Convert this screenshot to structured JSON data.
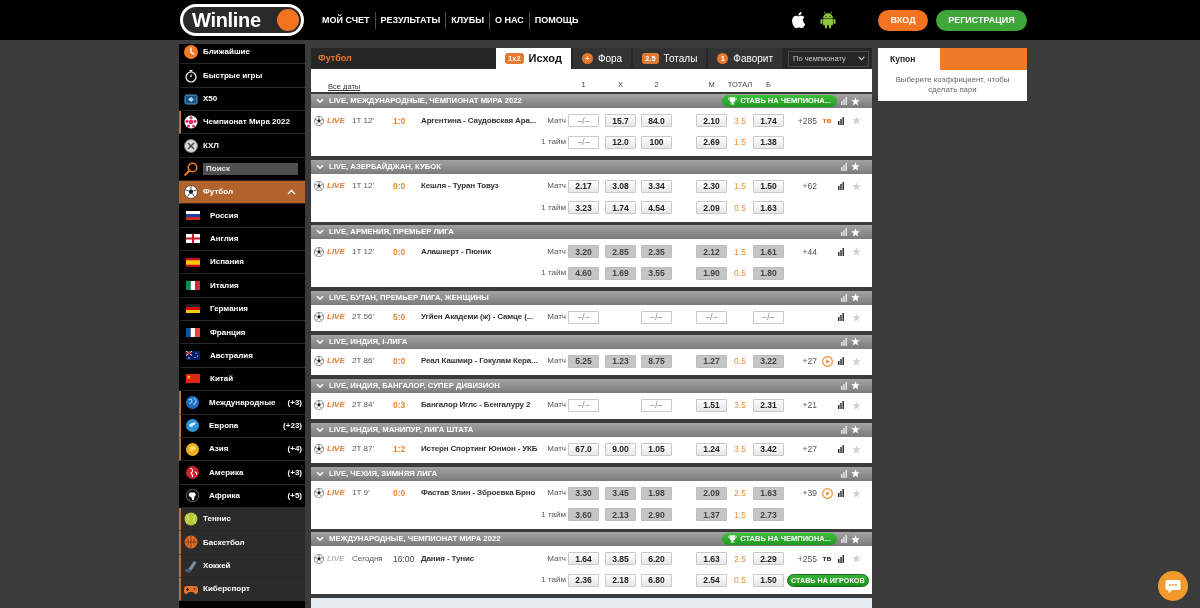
{
  "header": {
    "logo": "Winline",
    "nav": [
      "МОЙ СЧЕТ",
      "РЕЗУЛЬТАТЫ",
      "КЛУБЫ",
      "О НАС",
      "ПОМОЩЬ"
    ],
    "buttons": [
      {
        "kind": "login",
        "label": "ВХОД"
      },
      {
        "kind": "register",
        "label": "РЕГИСТРАЦИЯ"
      }
    ]
  },
  "sidebar": {
    "items": [
      {
        "kind": "link",
        "label": "Ближайшие",
        "selected": false,
        "live": false
      },
      {
        "kind": "link",
        "label": "Быстрые игры",
        "selected": false,
        "live": false
      },
      {
        "kind": "link",
        "label": "X50",
        "selected": false,
        "live": false
      },
      {
        "kind": "link",
        "label": "Чемпионат Мира 2022",
        "selected": false,
        "live": true
      },
      {
        "kind": "link",
        "label": "КХЛ",
        "selected": false,
        "live": false
      },
      {
        "kind": "search",
        "placeholder": "Поиск"
      },
      {
        "kind": "sport",
        "label": "Футбол",
        "selected": true,
        "live": false,
        "expanded": true,
        "children": [
          {
            "label": "Россия",
            "live": false
          },
          {
            "label": "Англия",
            "live": false
          },
          {
            "label": "Испания",
            "live": false
          },
          {
            "label": "Италия",
            "live": false
          },
          {
            "label": "Германия",
            "live": false
          },
          {
            "label": "Франция",
            "live": false
          },
          {
            "label": "Австралия",
            "live": false
          },
          {
            "label": "Китай",
            "live": false
          },
          {
            "label": "Международные",
            "count": "(+3)",
            "live": true
          },
          {
            "label": "Европа",
            "count": "(+23)",
            "live": true
          },
          {
            "label": "Азия",
            "count": "(+4)",
            "live": true
          },
          {
            "label": "Америка",
            "count": "(+3)",
            "live": false
          },
          {
            "label": "Африка",
            "count": "(+5)",
            "live": false
          }
        ]
      },
      {
        "kind": "sport",
        "label": "Теннис",
        "selected": false,
        "live": true
      },
      {
        "kind": "sport",
        "label": "Баскетбол",
        "selected": false,
        "live": true
      },
      {
        "kind": "sport",
        "label": "Хоккей",
        "selected": false,
        "live": true
      },
      {
        "kind": "sport",
        "label": "Киберспорт",
        "selected": false,
        "live": true
      }
    ]
  },
  "events": {
    "sport": "Футбол",
    "tabs": [
      {
        "kind": "pill",
        "badge": "1x2",
        "label": "Исход",
        "selected": true
      },
      {
        "kind": "circle",
        "badge": "+",
        "label": "Фора",
        "selected": false
      },
      {
        "kind": "pill",
        "badge": "2.5",
        "label": "Тоталы",
        "selected": false
      },
      {
        "kind": "circle",
        "badge": "1",
        "label": "Фаворит",
        "selected": false
      }
    ],
    "filter": "По чемпионату",
    "dates_link": "Все даты",
    "columns": [
      "1",
      "X",
      "2",
      "М",
      "ТОТАЛ",
      "Б"
    ],
    "groups": [
      {
        "title": "LIVE, МЕЖДУНАРОДНЫЕ, ЧЕМПИОНАТ МИРА 2022",
        "promo": "СТАВЬ НА ЧЕМПИОНА...",
        "matches": [
          {
            "live": true,
            "status": "LIVE",
            "period": "1Т 12'",
            "score": "1:0",
            "teams": "Аргентина - Саудовская Ара...",
            "more": "+285",
            "tv": {
              "label": "тв",
              "active": true
            },
            "video": false,
            "favorite": false,
            "lines": [
              {
                "label": "Матч",
                "win1": {
                  "value": "–/–",
                  "kind": "empty"
                },
                "draw": {
                  "value": "15.7",
                  "kind": "open"
                },
                "win2": {
                  "value": "84.0",
                  "kind": "open"
                },
                "under": {
                  "value": "2.10",
                  "kind": "open"
                },
                "total": "3.5",
                "over": {
                  "value": "1.74",
                  "kind": "open"
                }
              },
              {
                "label": "1 тайм",
                "win1": {
                  "value": "–/–",
                  "kind": "empty"
                },
                "draw": {
                  "value": "12.0",
                  "kind": "open"
                },
                "win2": {
                  "value": "100",
                  "kind": "open"
                },
                "under": {
                  "value": "2.69",
                  "kind": "open"
                },
                "total": "1.5",
                "over": {
                  "value": "1.38",
                  "kind": "open"
                }
              }
            ]
          }
        ]
      },
      {
        "title": "LIVE, АЗЕРБАЙДЖАН, КУБОК",
        "matches": [
          {
            "live": true,
            "status": "LIVE",
            "period": "1Т 12'",
            "score": "0:0",
            "teams": "Кешля - Туран Товуз",
            "more": "+62",
            "video": false,
            "favorite": false,
            "lines": [
              {
                "label": "Матч",
                "win1": {
                  "value": "2.17",
                  "kind": "open"
                },
                "draw": {
                  "value": "3.08",
                  "kind": "open"
                },
                "win2": {
                  "value": "3.34",
                  "kind": "open"
                },
                "under": {
                  "value": "2.30",
                  "kind": "open"
                },
                "total": "1.5",
                "over": {
                  "value": "1.50",
                  "kind": "open"
                }
              },
              {
                "label": "1 тайм",
                "win1": {
                  "value": "3.23",
                  "kind": "open"
                },
                "draw": {
                  "value": "1.74",
                  "kind": "open"
                },
                "win2": {
                  "value": "4.54",
                  "kind": "open"
                },
                "under": {
                  "value": "2.09",
                  "kind": "open"
                },
                "total": "0.5",
                "over": {
                  "value": "1.63",
                  "kind": "open"
                }
              }
            ]
          }
        ]
      },
      {
        "title": "LIVE, АРМЕНИЯ, ПРЕМЬЕР ЛИГА",
        "matches": [
          {
            "live": true,
            "status": "LIVE",
            "period": "1Т 12'",
            "score": "0:0",
            "teams": "Алашкерт - Пюник",
            "more": "+44",
            "video": false,
            "favorite": false,
            "lines": [
              {
                "label": "Матч",
                "win1": {
                  "value": "3.20",
                  "kind": "locked"
                },
                "draw": {
                  "value": "2.85",
                  "kind": "locked"
                },
                "win2": {
                  "value": "2.35",
                  "kind": "locked"
                },
                "under": {
                  "value": "2.12",
                  "kind": "locked"
                },
                "total": "1.5",
                "over": {
                  "value": "1.61",
                  "kind": "locked"
                }
              },
              {
                "label": "1 тайм",
                "win1": {
                  "value": "4.60",
                  "kind": "locked"
                },
                "draw": {
                  "value": "1.69",
                  "kind": "locked"
                },
                "win2": {
                  "value": "3.55",
                  "kind": "locked"
                },
                "under": {
                  "value": "1.90",
                  "kind": "locked"
                },
                "total": "0.5",
                "over": {
                  "value": "1.80",
                  "kind": "locked"
                }
              }
            ]
          }
        ]
      },
      {
        "title": "LIVE, БУТАН, ПРЕМЬЕР ЛИГА, ЖЕНЩИНЫ",
        "matches": [
          {
            "live": true,
            "status": "LIVE",
            "period": "2Т 56'",
            "score": "5:0",
            "teams": "Угйен Академи (ж) - Самце (...",
            "video": false,
            "favorite": false,
            "lines": [
              {
                "label": "Матч",
                "win1": {
                  "value": "–/–",
                  "kind": "empty"
                },
                "win2": {
                  "value": "–/–",
                  "kind": "empty"
                },
                "under": {
                  "value": "–/–",
                  "kind": "empty"
                },
                "over": {
                  "value": "–/–",
                  "kind": "empty"
                }
              }
            ]
          }
        ]
      },
      {
        "title": "LIVE, ИНДИЯ, I-ЛИГА",
        "matches": [
          {
            "live": true,
            "status": "LIVE",
            "period": "2Т 86'",
            "score": "0:0",
            "teams": "Реал Кашмир - Гокулам Кера...",
            "more": "+27",
            "video": true,
            "favorite": false,
            "lines": [
              {
                "label": "Матч",
                "win1": {
                  "value": "5.25",
                  "kind": "locked"
                },
                "draw": {
                  "value": "1.23",
                  "kind": "locked"
                },
                "win2": {
                  "value": "8.75",
                  "kind": "locked"
                },
                "under": {
                  "value": "1.27",
                  "kind": "locked"
                },
                "total": "0.5",
                "over": {
                  "value": "3.22",
                  "kind": "locked"
                }
              }
            ]
          }
        ]
      },
      {
        "title": "LIVE, ИНДИЯ, БАНГАЛОР, СУПЕР ДИВИЗИОН",
        "matches": [
          {
            "live": true,
            "status": "LIVE",
            "period": "2Т 84'",
            "score": "0:3",
            "teams": "Бангалор Иглс - Бенгалуру 2",
            "more": "+21",
            "video": false,
            "favorite": false,
            "lines": [
              {
                "label": "Матч",
                "win1": {
                  "value": "–/–",
                  "kind": "empty"
                },
                "win2": {
                  "value": "–/–",
                  "kind": "empty"
                },
                "under": {
                  "value": "1.51",
                  "kind": "open"
                },
                "total": "3.5",
                "over": {
                  "value": "2.31",
                  "kind": "open"
                }
              }
            ]
          }
        ]
      },
      {
        "title": "LIVE, ИНДИЯ, МАНИПУР, ЛИГА ШТАТА",
        "matches": [
          {
            "live": true,
            "status": "LIVE",
            "period": "2Т 87'",
            "score": "1:2",
            "teams": "Истерн Спортинг Юнион - УКБ",
            "more": "+27",
            "video": false,
            "favorite": false,
            "lines": [
              {
                "label": "Матч",
                "win1": {
                  "value": "67.0",
                  "kind": "open"
                },
                "draw": {
                  "value": "9.00",
                  "kind": "open"
                },
                "win2": {
                  "value": "1.05",
                  "kind": "open"
                },
                "under": {
                  "value": "1.24",
                  "kind": "open"
                },
                "total": "3.5",
                "over": {
                  "value": "3.42",
                  "kind": "open"
                }
              }
            ]
          }
        ]
      },
      {
        "title": "LIVE, ЧЕХИЯ, ЗИМНЯЯ ЛИГА",
        "matches": [
          {
            "live": true,
            "status": "LIVE",
            "period": "1Т 9'",
            "score": "0:0",
            "teams": "Фастав Злин - Зброевка Брно",
            "more": "+39",
            "video": true,
            "favorite": false,
            "lines": [
              {
                "label": "Матч",
                "win1": {
                  "value": "3.30",
                  "kind": "locked"
                },
                "draw": {
                  "value": "3.45",
                  "kind": "locked"
                },
                "win2": {
                  "value": "1.98",
                  "kind": "locked"
                },
                "under": {
                  "value": "2.09",
                  "kind": "locked"
                },
                "total": "2.5",
                "over": {
                  "value": "1.63",
                  "kind": "locked"
                }
              },
              {
                "label": "1 тайм",
                "win1": {
                  "value": "3.60",
                  "kind": "locked"
                },
                "draw": {
                  "value": "2.13",
                  "kind": "locked"
                },
                "win2": {
                  "value": "2.90",
                  "kind": "locked"
                },
                "under": {
                  "value": "1.37",
                  "kind": "locked"
                },
                "total": "1.5",
                "over": {
                  "value": "2.73",
                  "kind": "locked"
                }
              }
            ]
          }
        ]
      },
      {
        "title": "МЕЖДУНАРОДНЫЕ, ЧЕМПИОНАТ МИРА 2022",
        "promo": "СТАВЬ НА ЧЕМПИОНА...",
        "matches": [
          {
            "live": false,
            "status": "LIVE",
            "period": "Сегодня",
            "score": "16:00",
            "teams": "Дания - Тунис",
            "more": "+255",
            "tv": {
              "label": "тв",
              "active": false
            },
            "video": false,
            "favorite": false,
            "lines": [
              {
                "label": "Матч",
                "win1": {
                  "value": "1.64",
                  "kind": "open"
                },
                "draw": {
                  "value": "3.85",
                  "kind": "open"
                },
                "win2": {
                  "value": "6.20",
                  "kind": "open"
                },
                "under": {
                  "value": "1.63",
                  "kind": "open"
                },
                "total": "2.5",
                "over": {
                  "value": "2.29",
                  "kind": "open"
                }
              },
              {
                "label": "1 тайм",
                "win1": {
                  "value": "2.36",
                  "kind": "open"
                },
                "draw": {
                  "value": "2.18",
                  "kind": "open"
                },
                "win2": {
                  "value": "6.80",
                  "kind": "open"
                },
                "under": {
                  "value": "2.54",
                  "kind": "open"
                },
                "total": "0.5",
                "over": {
                  "value": "1.50",
                  "kind": "open"
                },
                "promo": "СТАВЬ НА ИГРОКОВ"
              }
            ]
          }
        ]
      }
    ]
  },
  "coupon": {
    "title": "Купон",
    "hint": "Выберите коэффициент, чтобы сделать пари"
  }
}
